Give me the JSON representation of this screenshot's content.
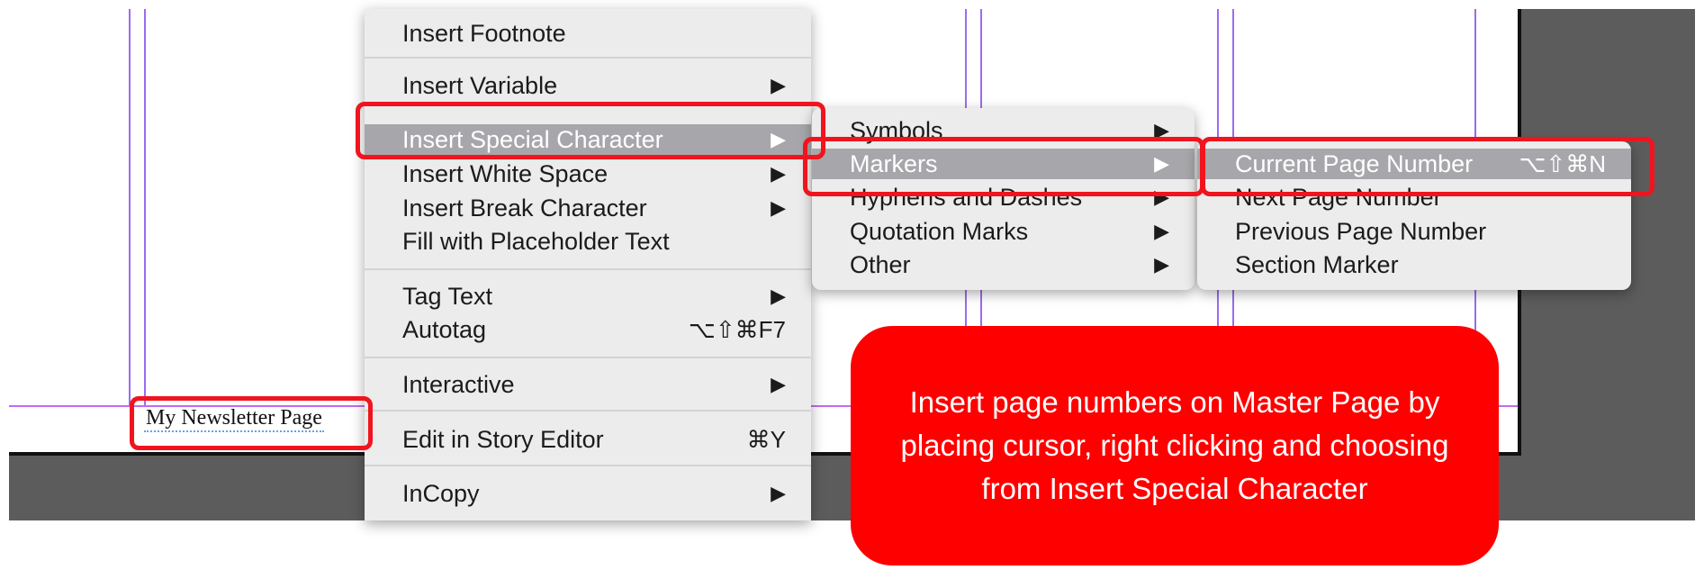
{
  "document": {
    "frame_text": "My Newsletter Page"
  },
  "context_menu": {
    "items": [
      {
        "label": "Insert Footnote",
        "has_submenu": false,
        "shortcut": ""
      },
      {
        "label": "Insert Variable",
        "has_submenu": true,
        "shortcut": ""
      },
      {
        "label": "Insert Special Character",
        "has_submenu": true,
        "shortcut": "",
        "highlighted": true
      },
      {
        "label": "Insert White Space",
        "has_submenu": true,
        "shortcut": ""
      },
      {
        "label": "Insert Break Character",
        "has_submenu": true,
        "shortcut": ""
      },
      {
        "label": "Fill with Placeholder Text",
        "has_submenu": false,
        "shortcut": ""
      },
      {
        "label": "Tag Text",
        "has_submenu": true,
        "shortcut": ""
      },
      {
        "label": "Autotag",
        "has_submenu": false,
        "shortcut": "⌥⇧⌘F7"
      },
      {
        "label": "Interactive",
        "has_submenu": true,
        "shortcut": ""
      },
      {
        "label": "Edit in Story Editor",
        "has_submenu": false,
        "shortcut": "⌘Y"
      },
      {
        "label": "InCopy",
        "has_submenu": true,
        "shortcut": ""
      }
    ]
  },
  "special_character_submenu": {
    "items": [
      {
        "label": "Symbols",
        "has_submenu": true
      },
      {
        "label": "Markers",
        "has_submenu": true,
        "highlighted": true
      },
      {
        "label": "Hyphens and Dashes",
        "has_submenu": true
      },
      {
        "label": "Quotation Marks",
        "has_submenu": true
      },
      {
        "label": "Other",
        "has_submenu": true
      }
    ]
  },
  "markers_submenu": {
    "items": [
      {
        "label": "Current Page Number",
        "shortcut": "⌥⇧⌘N",
        "highlighted": true
      },
      {
        "label": "Next Page Number",
        "shortcut": ""
      },
      {
        "label": "Previous Page Number",
        "shortcut": ""
      },
      {
        "label": "Section Marker",
        "shortcut": ""
      }
    ]
  },
  "callout": {
    "text": "Insert page numbers on Master Page by placing cursor, right clicking and choosing from Insert Special Character"
  },
  "icons": {
    "submenu_arrow": "triangle-right-icon"
  },
  "colors": {
    "callout_bg": "#fe0000",
    "annotation_box": "#f0141e",
    "menu_highlight": "#a7a7ab",
    "guide": "#9b6cf0"
  }
}
